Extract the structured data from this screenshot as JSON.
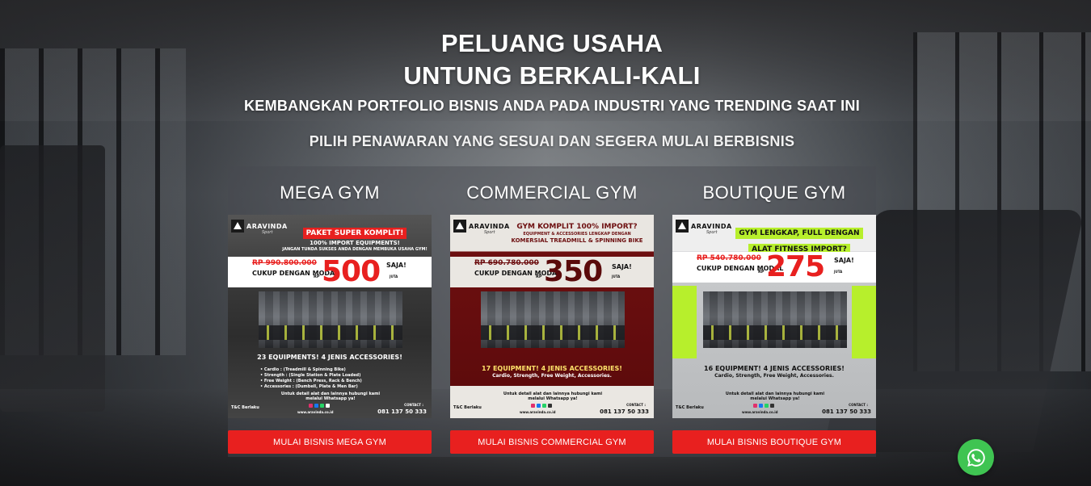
{
  "hero": {
    "title_line1": "PELUANG USAHA",
    "title_line2": "UNTUNG BERKALI-KALI",
    "subtitle": "KEMBANGKAN PORTFOLIO BISNIS ANDA PADA INDUSTRI YANG TRENDING SAAT INI",
    "prompt": "PILIH PENAWARAN YANG SESUAI DAN SEGERA MULAI BERBISNIS"
  },
  "packages": [
    {
      "title": "MEGA GYM",
      "button": "MULAI BISNIS MEGA GYM",
      "poster": {
        "brand": "ARAVINDA",
        "brand_tag": "Sport",
        "head1": "PAKET SUPER KOMPLIT!",
        "head2": "100% IMPORT EQUIPMENTS!",
        "head3": "JANGAN TUNDA SUKSES ANDA DENGAN MEMBUKA USAHA GYM!",
        "old_price": "RP 990.800.000",
        "cukup": "CUKUP DENGAN MODAL",
        "rp": "RP",
        "price": "500",
        "saja": "SAJA!",
        "juta": "JUTA",
        "equip_line": "23 EQUIPMENTS! 4 JENIS ACCESSORIES!",
        "specs": [
          "• Cardio        : (Treadmill & Spinning Bike)",
          "• Strength      : (Single Station & Plate Loaded)",
          "• Free Weight : (Bench Press, Rack & Bench)",
          "• Accessories  : (Dumbell, Plate & Men Bar)"
        ],
        "contact_msg": "Untuk detail alat dan lainnya hubungi kami melalui Whatsapp ya!",
        "tc": "T&C Berlaku",
        "web": "www.aravinda.co.id",
        "contact_label": "CONTACT :",
        "phone": "081 137 50 333"
      }
    },
    {
      "title": "COMMERCIAL GYM",
      "button": "MULAI BISNIS COMMERCIAL GYM",
      "poster": {
        "brand": "ARAVINDA",
        "brand_tag": "Sport",
        "head1": "GYM KOMPLIT 100% IMPORT?",
        "head2": "EQUIPMENT & ACCESSORIES LENGKAP DENGAN",
        "head3": "KOMERSIAL TREADMILL & SPINNING BIKE",
        "old_price": "RP 690.780.000",
        "cukup": "CUKUP DENGAN MODAL",
        "rp": "RP",
        "price": "350",
        "saja": "SAJA!",
        "juta": "JUTA",
        "equip_line": "17 EQUIPMENT! 4 JENIS ACCESSORIES!",
        "equip_sub": "Cardio, Strength, Free Weight, Accessories.",
        "contact_msg": "Untuk detail alat dan lainnya hubungi kami melalui Whatsapp ya!",
        "tc": "T&C Berlaku",
        "web": "www.aravinda.co.id",
        "contact_label": "CONTACT :",
        "phone": "081 137 50 333"
      }
    },
    {
      "title": "BOUTIQUE GYM",
      "button": "MULAI BISNIS BOUTIQUE GYM",
      "poster": {
        "brand": "ARAVINDA",
        "brand_tag": "Sport",
        "head1": "GYM LENGKAP, FULL DENGAN",
        "head2": "ALAT FITNESS IMPORT?",
        "old_price": "RP 540.780.000",
        "cukup": "CUKUP DENGAN MODAL",
        "rp": "RP",
        "price": "275",
        "saja": "SAJA!",
        "juta": "JUTA",
        "equip_line": "16 EQUIPMENT! 4 JENIS ACCESSORIES!",
        "equip_sub": "Cardio, Strength, Free Weight, Accessories.",
        "contact_msg": "Untuk detail alat dan lainnya hubungi kami melalui Whatsapp ya!",
        "tc": "T&C Berlaku",
        "web": "www.aravinda.co.id",
        "contact_label": "CONTACT :",
        "phone": "081 137 50 333"
      }
    }
  ],
  "colors": {
    "accent_red": "#e8201f",
    "maroon": "#6d0f10",
    "lime": "#b7ef2c",
    "whatsapp_green": "#3fc452"
  },
  "floating": {
    "icon": "whatsapp-icon"
  }
}
